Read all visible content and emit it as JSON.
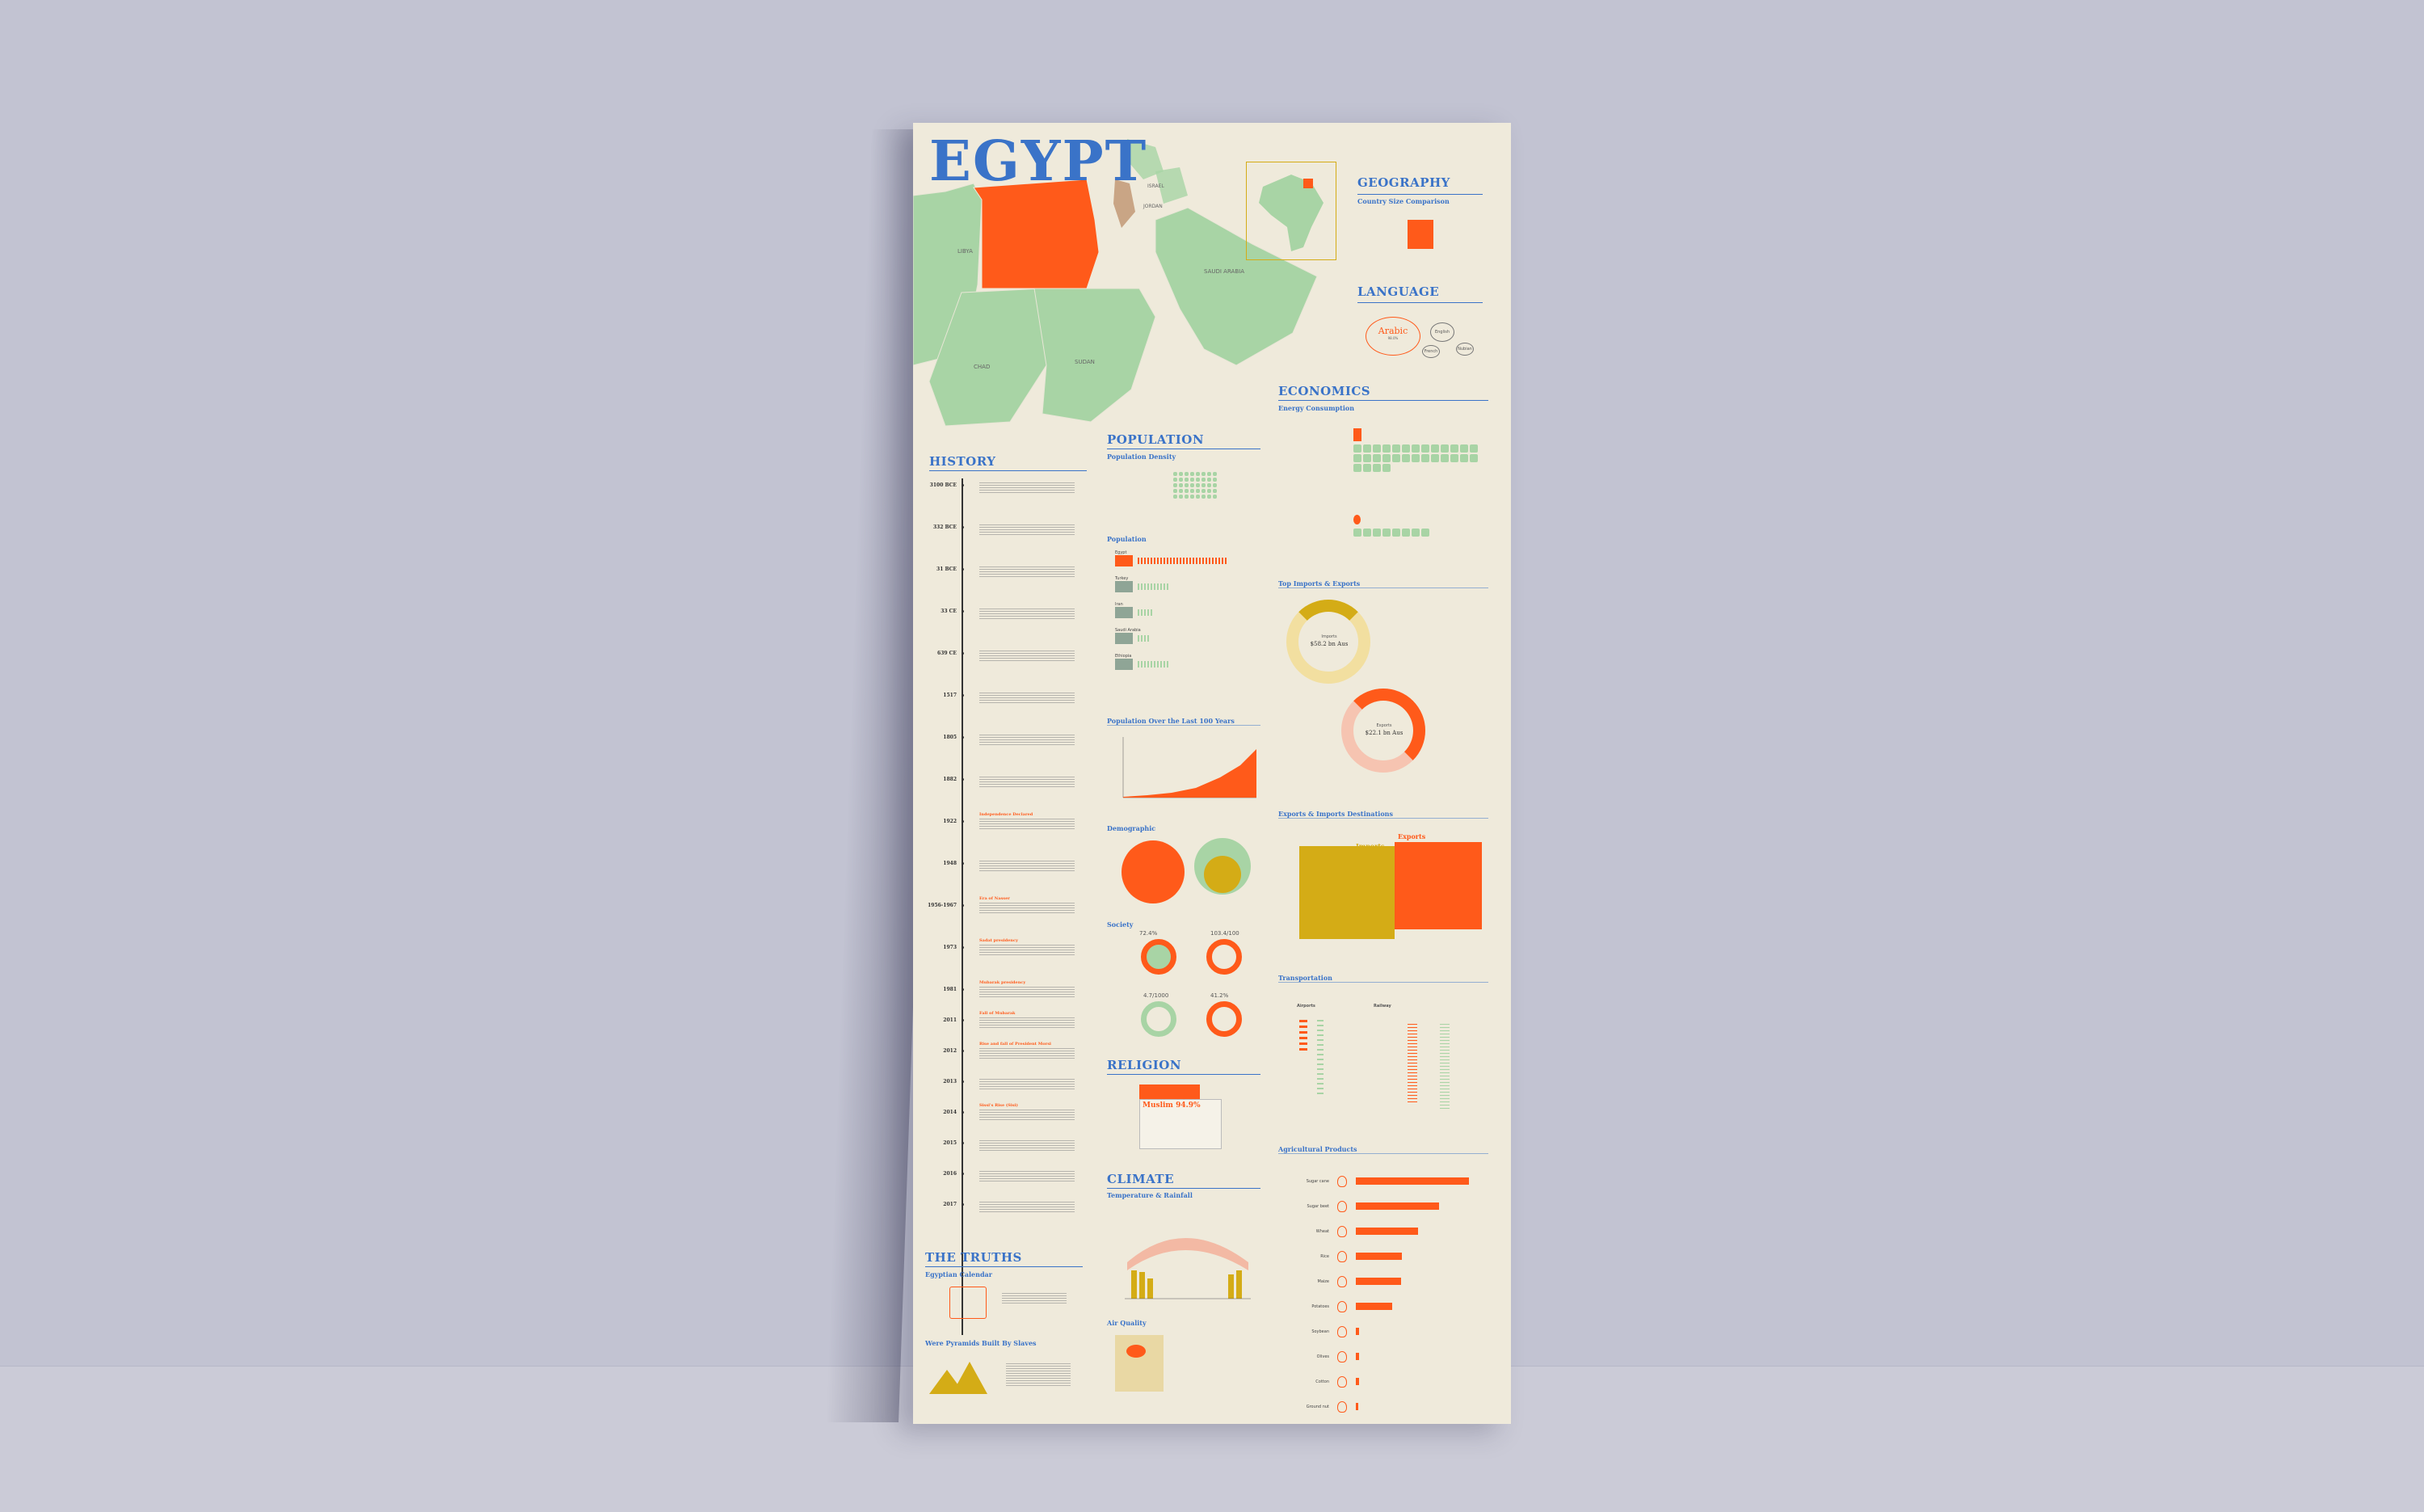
{
  "poster": {
    "title": "EGYPT",
    "colors": {
      "accent_blue": "#3a73c8",
      "accent_orange": "#ff5a1a",
      "green": "#a8d4a5",
      "gold": "#d4ac16",
      "paper": "#efeadb"
    },
    "map": {
      "countries": [
        "LIBYA",
        "CHAD",
        "SUDAN",
        "SAUDI ARABIA",
        "ISRAEL",
        "JORDAN"
      ]
    },
    "geography": {
      "heading": "GEOGRAPHY",
      "sub": "Country Size Comparison"
    },
    "language": {
      "heading": "LANGUAGE",
      "main": "Arabic",
      "main_pct": "98.0%",
      "others": [
        "English",
        "French",
        "Nubian"
      ]
    },
    "history": {
      "heading": "HISTORY",
      "events": [
        {
          "year": "3100 BCE"
        },
        {
          "year": "332 BCE"
        },
        {
          "year": "31 BCE"
        },
        {
          "year": "33 CE"
        },
        {
          "year": "639 CE"
        },
        {
          "year": "1517"
        },
        {
          "year": "1805"
        },
        {
          "year": "1882"
        },
        {
          "year": "1922",
          "label": "Independence Declared"
        },
        {
          "year": "1948"
        },
        {
          "year": "1956-1967",
          "label": "Era of Nasser"
        },
        {
          "year": "1973",
          "label": "Sadat presidency"
        },
        {
          "year": "1981",
          "label": "Mubarak presidency"
        },
        {
          "year": "2011",
          "label": "Fall of Mubarak"
        },
        {
          "year": "2012",
          "label": "Rise and fall of President Morsi"
        },
        {
          "year": "2013"
        },
        {
          "year": "2014",
          "label": "Sissi's Rise (Sisi)"
        },
        {
          "year": "2015"
        },
        {
          "year": "2016"
        },
        {
          "year": "2017"
        }
      ]
    },
    "population": {
      "heading": "POPULATION",
      "density": "Population Density",
      "population": "Population",
      "over_years": "Population Over the Last 100 Years",
      "demographic": "Demographic",
      "society": "Society",
      "society_values": [
        "72.4%",
        "103.4/100",
        "4.7/1000",
        "41.2%"
      ],
      "rows": [
        "Egypt",
        "Turkey",
        "Iran",
        "Saudi Arabia",
        "Ethiopia"
      ]
    },
    "religion": {
      "heading": "RELIGION",
      "main": "Muslim 94.9%"
    },
    "climate": {
      "heading": "CLIMATE",
      "sub": "Temperature & Rainfall",
      "air": "Air Quality"
    },
    "truths": {
      "heading": "THE TRUTHS",
      "item1": "Egyptian Calendar",
      "item2": "Were Pyramids Built By Slaves"
    },
    "economics": {
      "heading": "ECONOMICS",
      "energy": "Energy Consumption",
      "trade": "Top Imports & Exports",
      "imports_label": "Imports",
      "imports_value": "$58.2 bn Aus",
      "exports_label": "Exports",
      "exports_value": "$22.1 bn Aus",
      "destinations": "Exports & Imports Destinations",
      "dest_imports": "Imports",
      "dest_exports": "Exports"
    },
    "transport": {
      "heading": "Transportation",
      "airports": "Airports",
      "railway": "Railway"
    },
    "agriculture": {
      "heading": "Agricultural Products",
      "items": [
        {
          "name": "Sugar cane",
          "value": 15
        },
        {
          "name": "Sugar beet",
          "value": 11
        },
        {
          "name": "Wheat",
          "value": 8.3
        },
        {
          "name": "Rice",
          "value": 6.1
        },
        {
          "name": "Maize",
          "value": 6
        },
        {
          "name": "Potatoes",
          "value": 4.8
        },
        {
          "name": "Soybean",
          "value": 0.4
        },
        {
          "name": "Olives",
          "value": 0.4
        },
        {
          "name": "Cotton",
          "value": 0.4
        },
        {
          "name": "Ground nut",
          "value": 0.3
        }
      ]
    }
  }
}
